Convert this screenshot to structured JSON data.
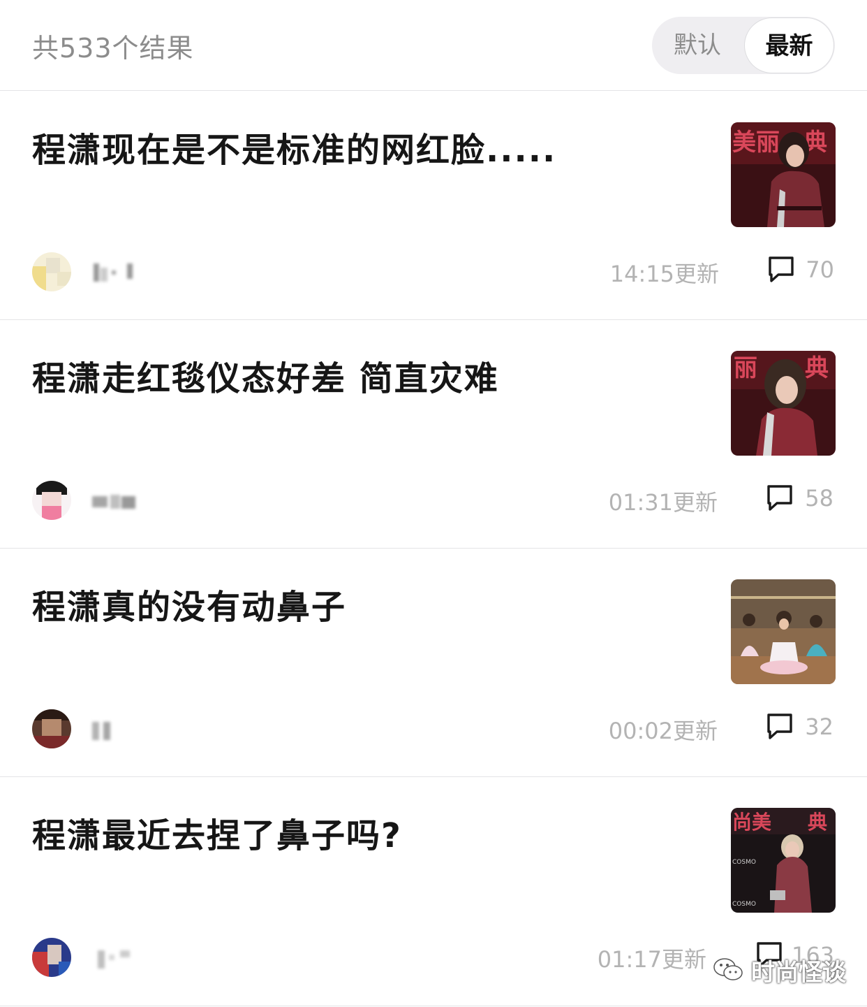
{
  "header": {
    "result_count": "共533个结果",
    "sort_default": "默认",
    "sort_latest": "最新"
  },
  "posts": [
    {
      "title": "程潇现在是不是标准的网红脸.....",
      "updated": "14:15更新",
      "comments": "70",
      "thumb_icon": "red-carpet-photo"
    },
    {
      "title": "程潇走红毯仪态好差 简直灾难",
      "updated": "01:31更新",
      "comments": "58",
      "thumb_icon": "red-carpet-photo"
    },
    {
      "title": "程潇真的没有动鼻子",
      "updated": "00:02更新",
      "comments": "32",
      "thumb_icon": "dance-class-photo"
    },
    {
      "title": "程潇最近去捏了鼻子吗?",
      "updated": "01:17更新",
      "comments": "163",
      "thumb_icon": "red-carpet-photo"
    }
  ],
  "watermark": {
    "text": "时尚怪谈",
    "icon": "wechat-icon"
  },
  "colors": {
    "muted_text": "#8c8c8c",
    "meta_text": "#b3b3b3",
    "divider": "#e4e4e6",
    "thumb_red": "#6e1a22"
  }
}
